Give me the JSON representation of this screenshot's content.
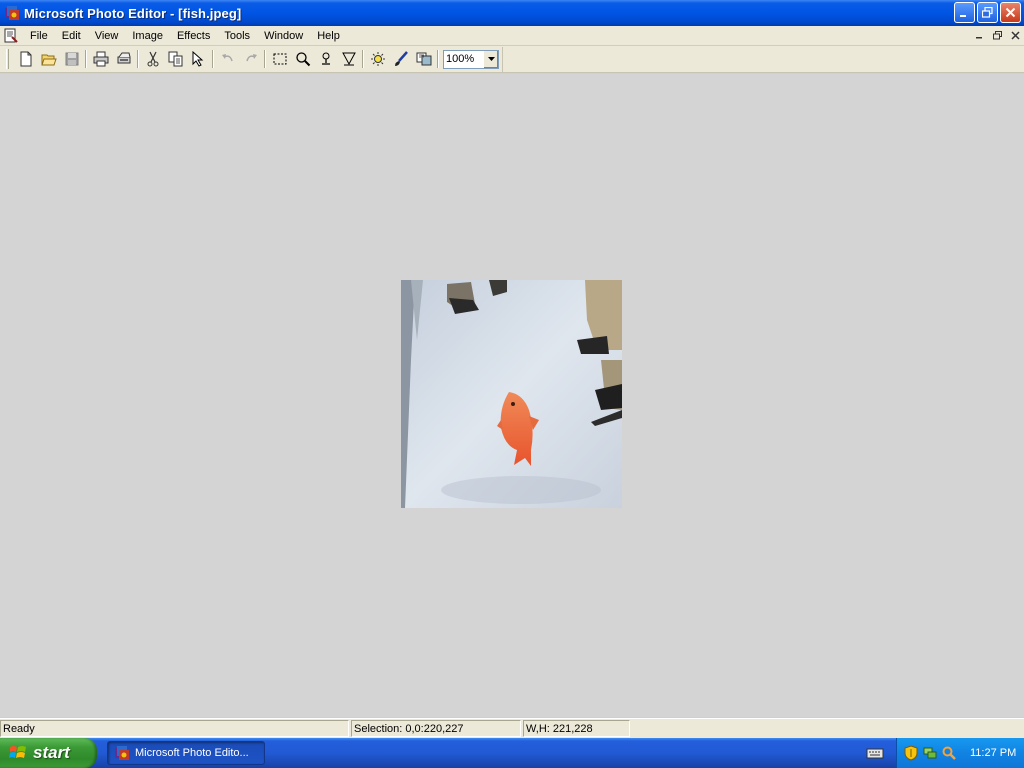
{
  "window": {
    "title": "Microsoft Photo Editor - [fish.jpeg]"
  },
  "menu": {
    "items": [
      "File",
      "Edit",
      "View",
      "Image",
      "Effects",
      "Tools",
      "Window",
      "Help"
    ]
  },
  "toolbar": {
    "buttons": [
      "new",
      "open",
      "save",
      "print",
      "scan",
      "cut",
      "copy",
      "paste",
      "undo",
      "redo",
      "select",
      "zoom",
      "smudge",
      "sharpen",
      "balance",
      "paint",
      "transparency"
    ],
    "zoom_value": "100%"
  },
  "image": {
    "filename": "fish.jpeg",
    "icon": "fish-image"
  },
  "status": {
    "ready": "Ready",
    "selection": "Selection: 0,0:220,227",
    "size": "W,H: 221,228"
  },
  "taskbar": {
    "start_label": "start",
    "task_label": "Microsoft Photo Edito...",
    "clock": "11:27 PM"
  },
  "colors": {
    "title_blue": "#0055e5",
    "taskbar_blue": "#245edb",
    "start_green": "#3c9a37",
    "workspace": "#d4d4d4",
    "chrome": "#ece9d8"
  }
}
